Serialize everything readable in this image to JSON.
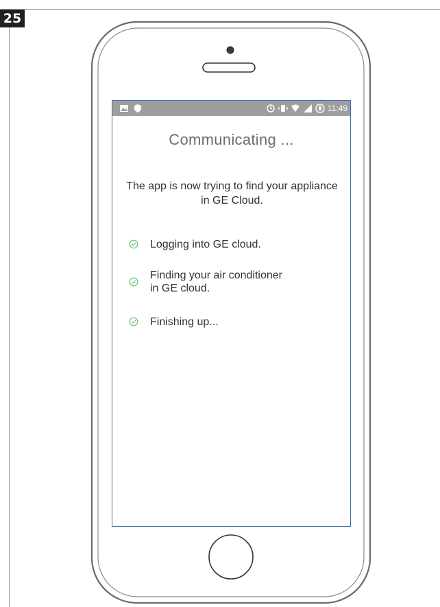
{
  "figure": {
    "step_number": "25"
  },
  "status_bar": {
    "time": "11:49",
    "left_icons": [
      "image-icon",
      "shield-icon"
    ],
    "right_icons": [
      "sync-icon",
      "vibrate-icon",
      "wifi-icon",
      "signal-icon",
      "battery-icon"
    ]
  },
  "screen": {
    "title": "Communicating ...",
    "message": "The app is now trying to find your appliance in GE Cloud.",
    "steps": [
      {
        "line1": "Logging into GE cloud.",
        "line2": ""
      },
      {
        "line1": "Finding your air conditioner",
        "line2": "in GE cloud."
      },
      {
        "line1": "Finishing up...",
        "line2": ""
      }
    ]
  },
  "colors": {
    "accent_check": "#6cbf6a",
    "screen_border": "#3e6fb3",
    "status_bar": "#9e9e9e"
  }
}
